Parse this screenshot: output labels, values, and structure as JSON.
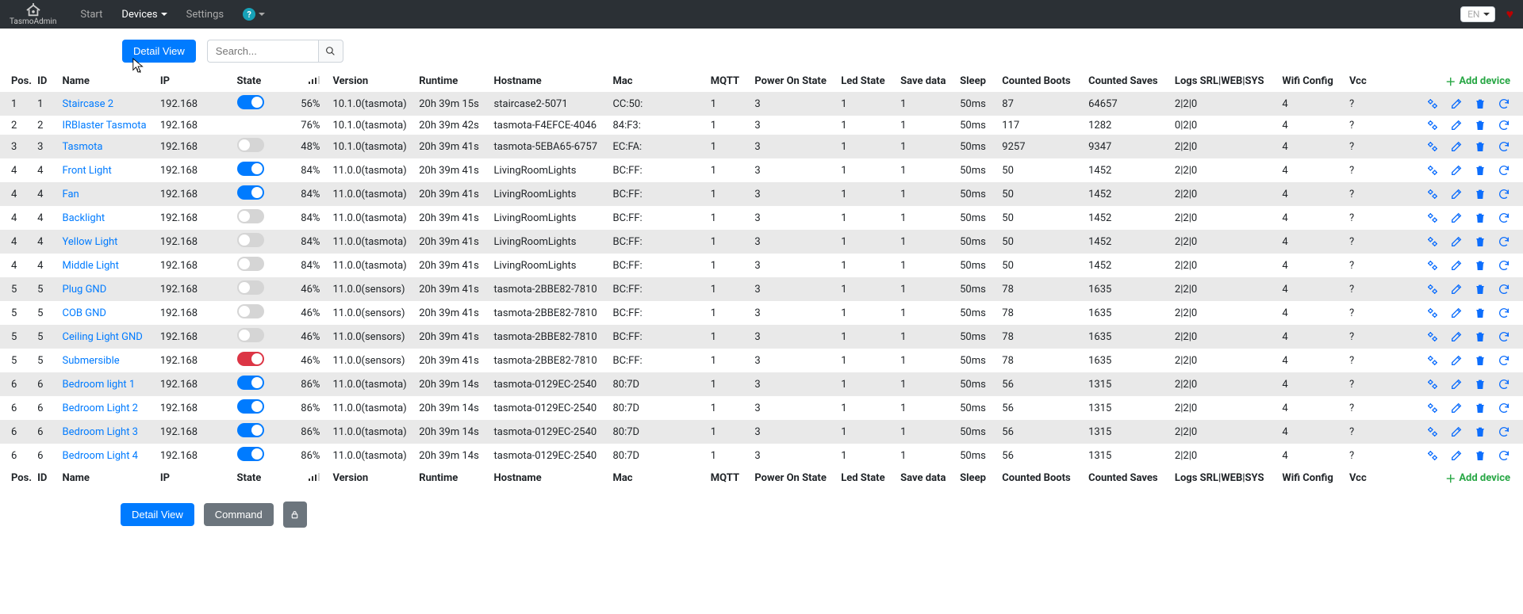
{
  "brand": "TasmoAdmin",
  "nav": {
    "start": "Start",
    "devices": "Devices",
    "settings": "Settings",
    "lang": "EN"
  },
  "toolbar": {
    "detail_view": "Detail View",
    "command": "Command",
    "search_placeholder": "Search...",
    "add_device": "Add device"
  },
  "columns": {
    "pos": "Pos.",
    "id": "ID",
    "name": "Name",
    "ip": "IP",
    "state": "State",
    "signal": "📶",
    "version": "Version",
    "runtime": "Runtime",
    "hostname": "Hostname",
    "mac": "Mac",
    "mqtt": "MQTT",
    "power_on": "Power On State",
    "led": "Led State",
    "save": "Save data",
    "sleep": "Sleep",
    "boots": "Counted Boots",
    "saves": "Counted Saves",
    "logs": "Logs SRL|WEB|SYS",
    "wifi": "Wifi Config",
    "vcc": "Vcc"
  },
  "rows": [
    {
      "pos": "1",
      "id": "1",
      "name": "Staircase 2",
      "ip": "192.168",
      "state": "on",
      "signal": "56%",
      "version": "10.1.0(tasmota)",
      "runtime": "20h 39m 15s",
      "hostname": "staircase2-5071",
      "mac": "CC:50:",
      "mqtt": "1",
      "power_on": "3",
      "led": "1",
      "save": "1",
      "sleep": "50ms",
      "boots": "87",
      "saves": "64657",
      "logs": "2|2|0",
      "wifi": "4",
      "vcc": "?",
      "alt": true
    },
    {
      "pos": "2",
      "id": "2",
      "name": "IRBlaster Tasmota",
      "ip": "192.168",
      "state": "",
      "signal": "76%",
      "version": "10.1.0(tasmota)",
      "runtime": "20h 39m 42s",
      "hostname": "tasmota-F4EFCE-4046",
      "mac": "84:F3:",
      "mqtt": "1",
      "power_on": "3",
      "led": "1",
      "save": "1",
      "sleep": "50ms",
      "boots": "117",
      "saves": "1282",
      "logs": "0|2|0",
      "wifi": "4",
      "vcc": "?",
      "alt": false
    },
    {
      "pos": "3",
      "id": "3",
      "name": "Tasmota",
      "ip": "192.168",
      "state": "off",
      "signal": "48%",
      "version": "10.1.0(tasmota)",
      "runtime": "20h 39m 41s",
      "hostname": "tasmota-5EBA65-6757",
      "mac": "EC:FA:",
      "mqtt": "1",
      "power_on": "3",
      "led": "1",
      "save": "1",
      "sleep": "50ms",
      "boots": "9257",
      "saves": "9347",
      "logs": "2|2|0",
      "wifi": "4",
      "vcc": "?",
      "alt": true
    },
    {
      "pos": "4",
      "id": "4",
      "name": "Front Light",
      "ip": "192.168",
      "state": "on",
      "signal": "84%",
      "version": "11.0.0(tasmota)",
      "runtime": "20h 39m 41s",
      "hostname": "LivingRoomLights",
      "mac": "BC:FF:",
      "mqtt": "1",
      "power_on": "3",
      "led": "1",
      "save": "1",
      "sleep": "50ms",
      "boots": "50",
      "saves": "1452",
      "logs": "2|2|0",
      "wifi": "4",
      "vcc": "?",
      "alt": false
    },
    {
      "pos": "4",
      "id": "4",
      "name": "Fan",
      "ip": "192.168",
      "state": "on",
      "signal": "84%",
      "version": "11.0.0(tasmota)",
      "runtime": "20h 39m 41s",
      "hostname": "LivingRoomLights",
      "mac": "BC:FF:",
      "mqtt": "1",
      "power_on": "3",
      "led": "1",
      "save": "1",
      "sleep": "50ms",
      "boots": "50",
      "saves": "1452",
      "logs": "2|2|0",
      "wifi": "4",
      "vcc": "?",
      "alt": true
    },
    {
      "pos": "4",
      "id": "4",
      "name": "Backlight",
      "ip": "192.168",
      "state": "off",
      "signal": "84%",
      "version": "11.0.0(tasmota)",
      "runtime": "20h 39m 41s",
      "hostname": "LivingRoomLights",
      "mac": "BC:FF:",
      "mqtt": "1",
      "power_on": "3",
      "led": "1",
      "save": "1",
      "sleep": "50ms",
      "boots": "50",
      "saves": "1452",
      "logs": "2|2|0",
      "wifi": "4",
      "vcc": "?",
      "alt": false
    },
    {
      "pos": "4",
      "id": "4",
      "name": "Yellow Light",
      "ip": "192.168",
      "state": "off",
      "signal": "84%",
      "version": "11.0.0(tasmota)",
      "runtime": "20h 39m 41s",
      "hostname": "LivingRoomLights",
      "mac": "BC:FF:",
      "mqtt": "1",
      "power_on": "3",
      "led": "1",
      "save": "1",
      "sleep": "50ms",
      "boots": "50",
      "saves": "1452",
      "logs": "2|2|0",
      "wifi": "4",
      "vcc": "?",
      "alt": true
    },
    {
      "pos": "4",
      "id": "4",
      "name": "Middle Light",
      "ip": "192.168",
      "state": "off",
      "signal": "84%",
      "version": "11.0.0(tasmota)",
      "runtime": "20h 39m 41s",
      "hostname": "LivingRoomLights",
      "mac": "BC:FF:",
      "mqtt": "1",
      "power_on": "3",
      "led": "1",
      "save": "1",
      "sleep": "50ms",
      "boots": "50",
      "saves": "1452",
      "logs": "2|2|0",
      "wifi": "4",
      "vcc": "?",
      "alt": false
    },
    {
      "pos": "5",
      "id": "5",
      "name": "Plug GND",
      "ip": "192.168",
      "state": "off",
      "signal": "46%",
      "version": "11.0.0(sensors)",
      "runtime": "20h 39m 41s",
      "hostname": "tasmota-2BBE82-7810",
      "mac": "BC:FF:",
      "mqtt": "1",
      "power_on": "3",
      "led": "1",
      "save": "1",
      "sleep": "50ms",
      "boots": "78",
      "saves": "1635",
      "logs": "2|2|0",
      "wifi": "4",
      "vcc": "?",
      "alt": true
    },
    {
      "pos": "5",
      "id": "5",
      "name": "COB GND",
      "ip": "192.168",
      "state": "off",
      "signal": "46%",
      "version": "11.0.0(sensors)",
      "runtime": "20h 39m 41s",
      "hostname": "tasmota-2BBE82-7810",
      "mac": "BC:FF:",
      "mqtt": "1",
      "power_on": "3",
      "led": "1",
      "save": "1",
      "sleep": "50ms",
      "boots": "78",
      "saves": "1635",
      "logs": "2|2|0",
      "wifi": "4",
      "vcc": "?",
      "alt": false
    },
    {
      "pos": "5",
      "id": "5",
      "name": "Ceiling Light GND",
      "ip": "192.168",
      "state": "off",
      "signal": "46%",
      "version": "11.0.0(sensors)",
      "runtime": "20h 39m 41s",
      "hostname": "tasmota-2BBE82-7810",
      "mac": "BC:FF:",
      "mqtt": "1",
      "power_on": "3",
      "led": "1",
      "save": "1",
      "sleep": "50ms",
      "boots": "78",
      "saves": "1635",
      "logs": "2|2|0",
      "wifi": "4",
      "vcc": "?",
      "alt": true
    },
    {
      "pos": "5",
      "id": "5",
      "name": "Submersible",
      "ip": "192.168",
      "state": "on-red",
      "signal": "46%",
      "version": "11.0.0(sensors)",
      "runtime": "20h 39m 41s",
      "hostname": "tasmota-2BBE82-7810",
      "mac": "BC:FF:",
      "mqtt": "1",
      "power_on": "3",
      "led": "1",
      "save": "1",
      "sleep": "50ms",
      "boots": "78",
      "saves": "1635",
      "logs": "2|2|0",
      "wifi": "4",
      "vcc": "?",
      "alt": false
    },
    {
      "pos": "6",
      "id": "6",
      "name": "Bedroom light 1",
      "ip": "192.168",
      "state": "on",
      "signal": "86%",
      "version": "11.0.0(tasmota)",
      "runtime": "20h 39m 14s",
      "hostname": "tasmota-0129EC-2540",
      "mac": "80:7D",
      "mqtt": "1",
      "power_on": "3",
      "led": "1",
      "save": "1",
      "sleep": "50ms",
      "boots": "56",
      "saves": "1315",
      "logs": "2|2|0",
      "wifi": "4",
      "vcc": "?",
      "alt": true
    },
    {
      "pos": "6",
      "id": "6",
      "name": "Bedroom Light 2",
      "ip": "192.168",
      "state": "on",
      "signal": "86%",
      "version": "11.0.0(tasmota)",
      "runtime": "20h 39m 14s",
      "hostname": "tasmota-0129EC-2540",
      "mac": "80:7D",
      "mqtt": "1",
      "power_on": "3",
      "led": "1",
      "save": "1",
      "sleep": "50ms",
      "boots": "56",
      "saves": "1315",
      "logs": "2|2|0",
      "wifi": "4",
      "vcc": "?",
      "alt": false
    },
    {
      "pos": "6",
      "id": "6",
      "name": "Bedroom Light 3",
      "ip": "192.168",
      "state": "on",
      "signal": "86%",
      "version": "11.0.0(tasmota)",
      "runtime": "20h 39m 14s",
      "hostname": "tasmota-0129EC-2540",
      "mac": "80:7D",
      "mqtt": "1",
      "power_on": "3",
      "led": "1",
      "save": "1",
      "sleep": "50ms",
      "boots": "56",
      "saves": "1315",
      "logs": "2|2|0",
      "wifi": "4",
      "vcc": "?",
      "alt": true
    },
    {
      "pos": "6",
      "id": "6",
      "name": "Bedroom Light 4",
      "ip": "192.168",
      "state": "on",
      "signal": "86%",
      "version": "11.0.0(tasmota)",
      "runtime": "20h 39m 14s",
      "hostname": "tasmota-0129EC-2540",
      "mac": "80:7D",
      "mqtt": "1",
      "power_on": "3",
      "led": "1",
      "save": "1",
      "sleep": "50ms",
      "boots": "56",
      "saves": "1315",
      "logs": "2|2|0",
      "wifi": "4",
      "vcc": "?",
      "alt": false
    }
  ]
}
